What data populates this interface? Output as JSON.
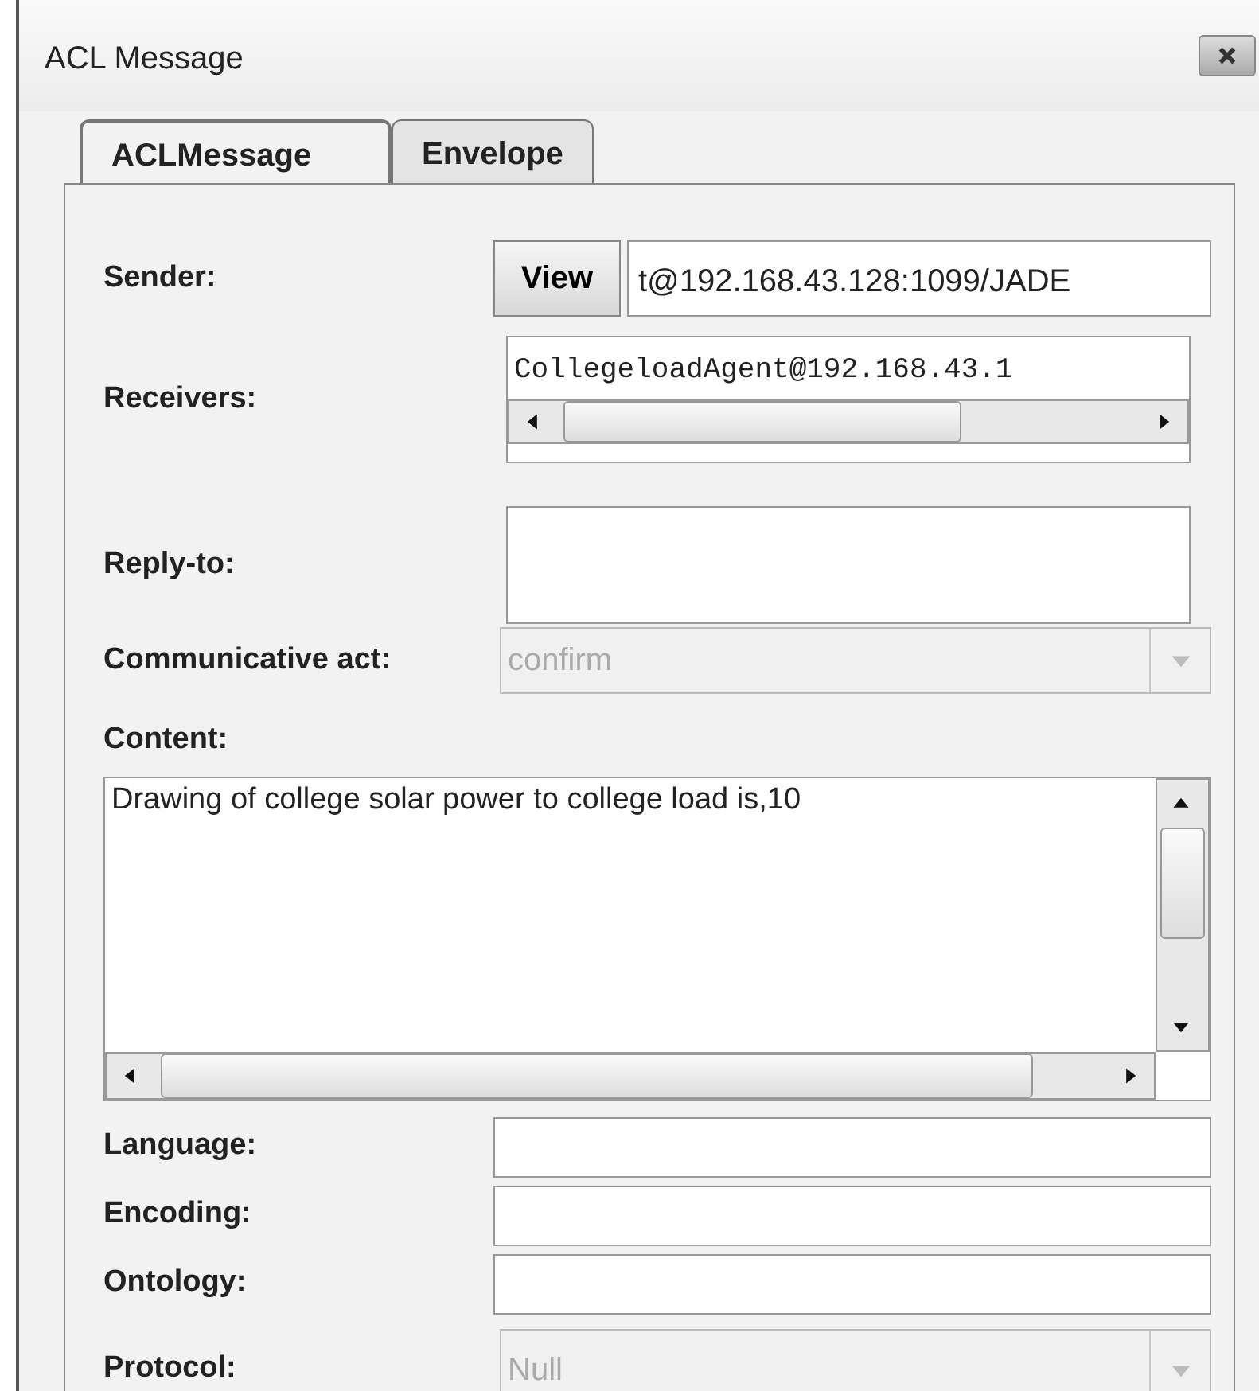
{
  "window": {
    "title": "ACL Message"
  },
  "tabs": [
    {
      "label": "ACLMessage",
      "selected": true
    },
    {
      "label": "Envelope",
      "selected": false
    }
  ],
  "rows": [
    {
      "kind": "sender",
      "label": "Sender:",
      "button": "View",
      "value": "t@192.168.43.128:1099/JADE"
    },
    {
      "kind": "list",
      "label": "Receivers:",
      "items": [
        "CollegeloadAgent@192.168.43.1"
      ]
    },
    {
      "kind": "box",
      "label": "Reply-to:"
    },
    {
      "kind": "combo",
      "label": "Communicative act:",
      "value": "confirm",
      "disabled": true
    },
    {
      "kind": "textarea",
      "label": "Content:",
      "value": "Drawing of college solar power to college load is,10"
    },
    {
      "kind": "field",
      "label": "Language:"
    },
    {
      "kind": "field",
      "label": "Encoding:"
    },
    {
      "kind": "field",
      "label": "Ontology:"
    },
    {
      "kind": "combo",
      "label": "Protocol:",
      "value": "Null",
      "disabled": true
    }
  ]
}
